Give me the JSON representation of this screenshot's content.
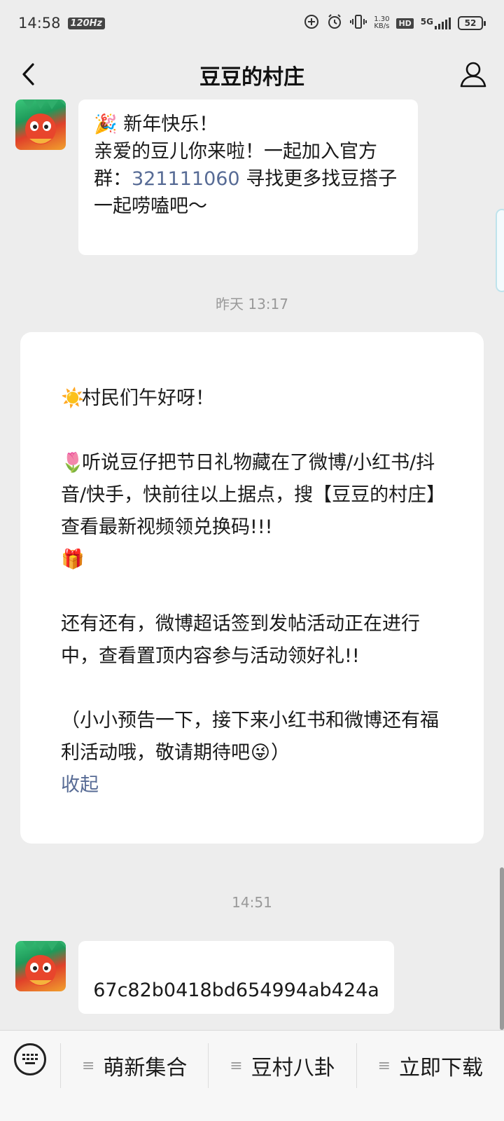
{
  "status_bar": {
    "time": "14:58",
    "refresh_rate": "120Hz",
    "net_speed_value": "1.30",
    "net_speed_unit": "KB/s",
    "hd_label": "HD",
    "network_type": "5G",
    "battery_level": "52",
    "icons": [
      "add-circle-icon",
      "alarm-icon",
      "vibrate-icon",
      "signal-icon",
      "battery-icon"
    ]
  },
  "nav": {
    "title": "豆豆的村庄",
    "back_icon": "chevron-left-icon",
    "profile_icon": "person-icon"
  },
  "messages": [
    {
      "type": "text",
      "lines": [
        {
          "emoji": "🎉",
          "text": "新年快乐！"
        },
        {
          "text": "亲爱的豆儿你来啦！一起加入官方"
        },
        {
          "prefix": "群：",
          "link": "321111060",
          "suffix": " 寻找更多找豆搭子"
        },
        {
          "text": "一起唠嗑吧～"
        }
      ]
    },
    {
      "type": "timestamp",
      "text": "昨天 13:17"
    },
    {
      "type": "card",
      "greeting_emoji": "☀️",
      "greeting": "村民们午好呀！",
      "para1_emoji": "🌷",
      "para1": "听说豆仔把节日礼物藏在了微博/小红书/抖音/快手，快前往以上据点，搜【豆豆的村庄】查看最新视频领兑换码!!!",
      "para1_tail_emoji": "🎁",
      "para2": "还有还有，微博超话签到发帖活动正在进行中，查看置顶内容参与活动领好礼!!",
      "para3": "（小小预告一下，接下来小红书和微博还有福利活动哦，敬请期待吧",
      "para3_emoji": "😜",
      "para3_close": "）",
      "collapse_label": "收起"
    },
    {
      "type": "timestamp",
      "text": "14:51"
    },
    {
      "type": "text",
      "text": "67c82b0418bd654994ab424a"
    }
  ],
  "bottom_menu": {
    "keyboard_icon": "keyboard-icon",
    "items": [
      {
        "label": "萌新集合",
        "icon": "menu-lines-icon"
      },
      {
        "label": "豆村八卦",
        "icon": "menu-lines-icon"
      },
      {
        "label": "立即下载",
        "icon": "menu-lines-icon"
      }
    ]
  },
  "colors": {
    "background": "#ededed",
    "bubble": "#ffffff",
    "link": "#576b95",
    "timestamp": "#999999"
  }
}
